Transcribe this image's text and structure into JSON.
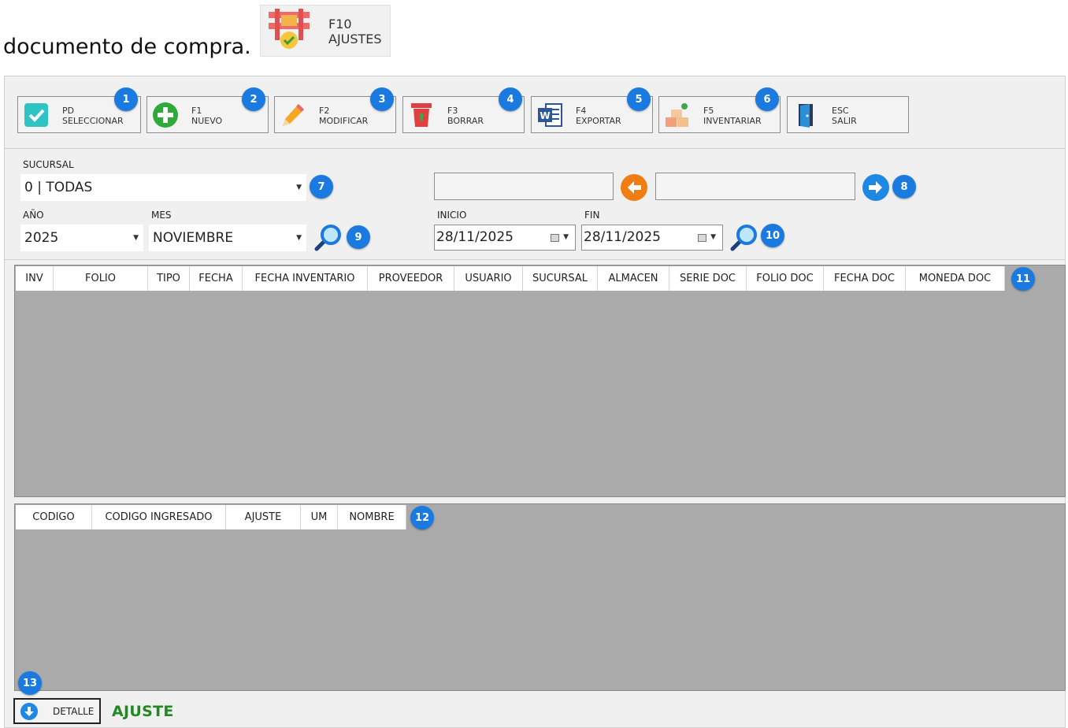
{
  "intro_text": "documento de compra.",
  "header_button": {
    "key": "F10",
    "label": "AJUSTES",
    "icon": "shelf-check-icon"
  },
  "toolbar": [
    {
      "key": "PD",
      "label": "SELECCIONAR",
      "icon": "checkbox-icon",
      "badge": "1"
    },
    {
      "key": "F1",
      "label": "NUEVO",
      "icon": "plus-circle-icon",
      "badge": "2"
    },
    {
      "key": "F2",
      "label": "MODIFICAR",
      "icon": "pencil-icon",
      "badge": "3"
    },
    {
      "key": "F3",
      "label": "BORRAR",
      "icon": "trash-icon",
      "badge": "4"
    },
    {
      "key": "F4",
      "label": "EXPORTAR",
      "icon": "word-icon",
      "badge": "5"
    },
    {
      "key": "F5",
      "label": "INVENTARIAR",
      "icon": "boxes-icon",
      "badge": "6"
    },
    {
      "key": "ESC",
      "label": "SALIR",
      "icon": "door-icon",
      "badge": ""
    }
  ],
  "filters": {
    "sucursal_label": "SUCURSAL",
    "sucursal_value": "0 | TODAS",
    "anio_label": "AÑO",
    "anio_value": "2025",
    "mes_label": "MES",
    "mes_value": "NOVIEMBRE",
    "inicio_label": "INICIO",
    "inicio_value": "28/11/2025",
    "fin_label": "FIN",
    "fin_value": "28/11/2025",
    "nav_left_value": "",
    "nav_right_value": ""
  },
  "badges": {
    "b7": "7",
    "b8": "8",
    "b9": "9",
    "b10": "10",
    "b11": "11",
    "b12": "12",
    "b13": "13"
  },
  "main_grid": {
    "columns": [
      "INV",
      "FOLIO",
      "TIPO",
      "FECHA",
      "FECHA INVENTARIO",
      "PROVEEDOR",
      "USUARIO",
      "SUCURSAL",
      "ALMACEN",
      "SERIE DOC",
      "FOLIO DOC",
      "FECHA DOC",
      "MONEDA DOC"
    ]
  },
  "detail_grid": {
    "columns": [
      "CODIGO",
      "CODIGO INGRESADO",
      "AJUSTE",
      "UM",
      "NOMBRE"
    ]
  },
  "bottom": {
    "detalle_label": "DETALLE",
    "status_text": "AJUSTE"
  },
  "colors": {
    "badge": "#1a7ae0",
    "status_green": "#1f8a1f",
    "grid_bg": "#aaaaaa",
    "arrow_left": "#f07d12",
    "arrow_right": "#1e88e5"
  }
}
